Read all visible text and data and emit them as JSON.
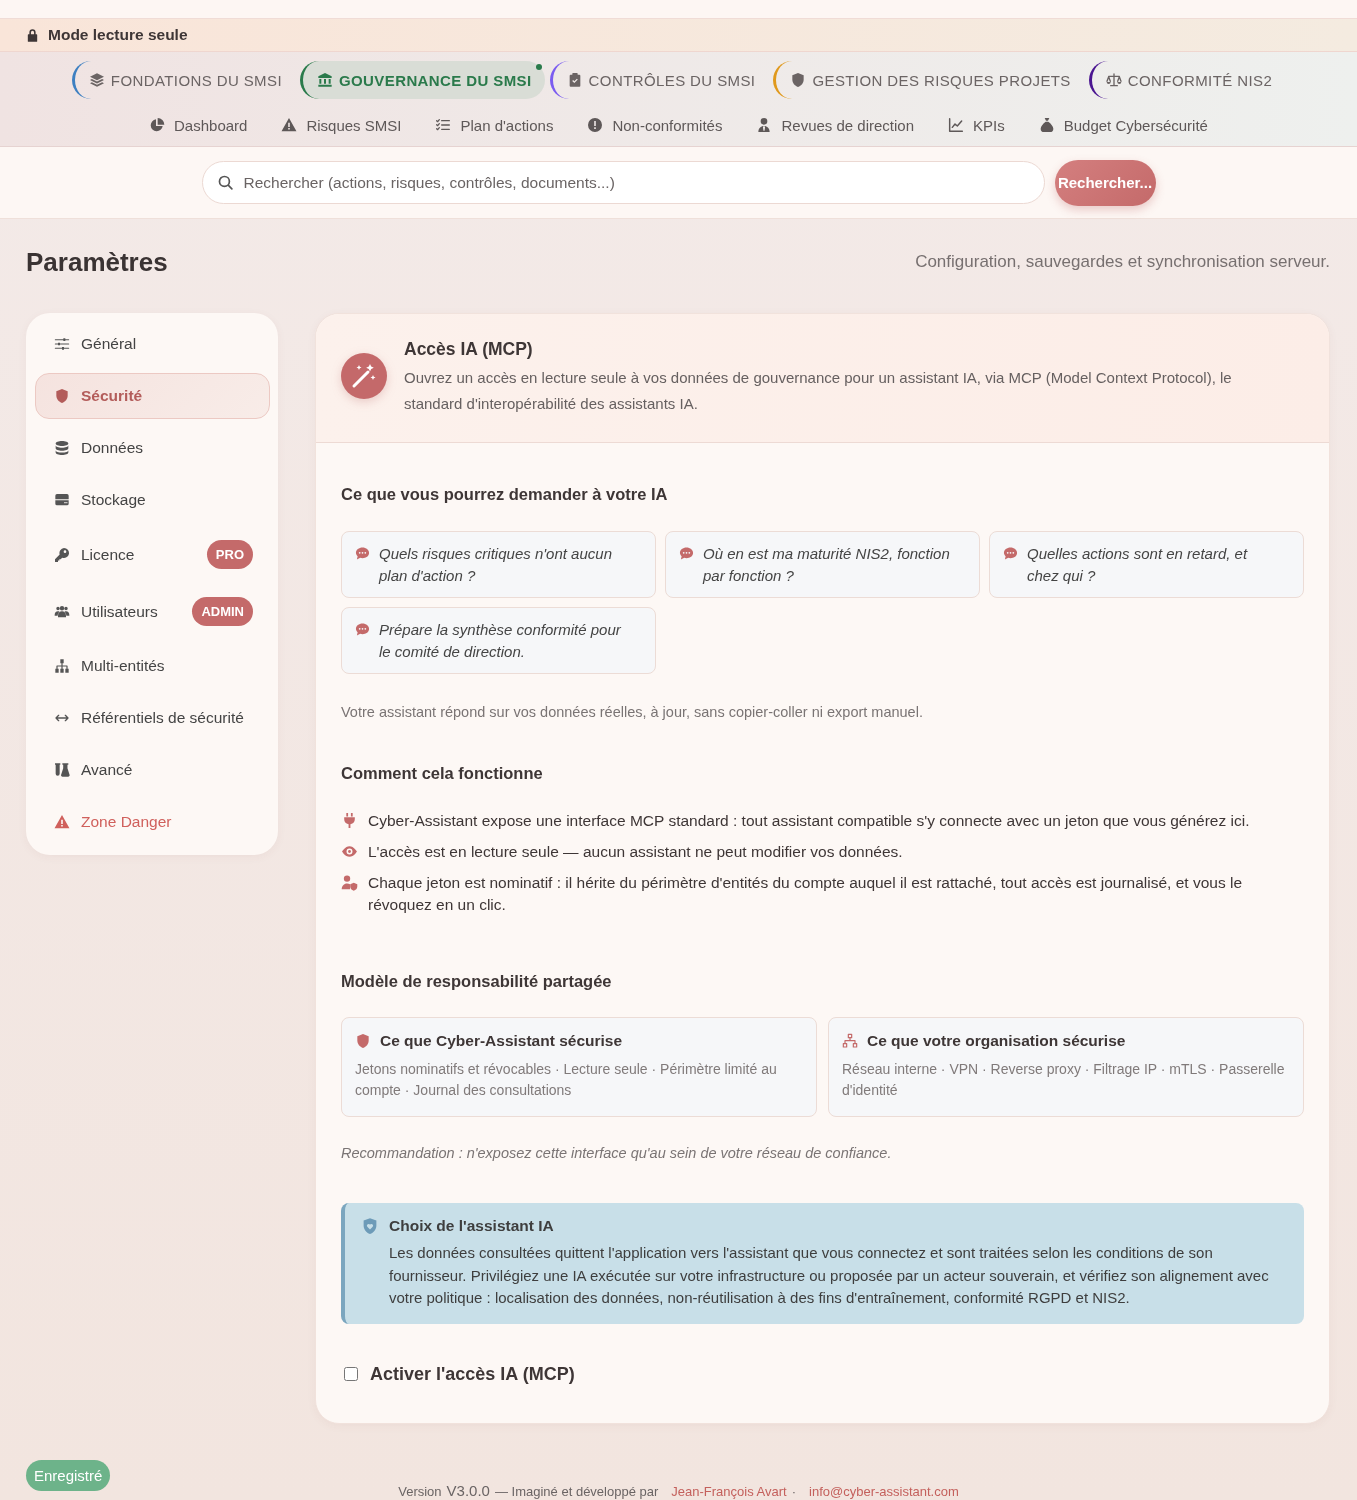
{
  "banner": {
    "text": "Mode lecture seule"
  },
  "modules": [
    {
      "label": "FONDATIONS DU SMSI",
      "color": "#3d7fc1",
      "selected": false
    },
    {
      "label": "GOUVERNANCE DU SMSI",
      "color": "#2a7a4b",
      "selected": true
    },
    {
      "label": "CONTRÔLES DU SMSI",
      "color": "#7b5cf0",
      "selected": false
    },
    {
      "label": "GESTION DES RISQUES PROJETS",
      "color": "#e0991c",
      "selected": false
    },
    {
      "label": "CONFORMITÉ NIS2",
      "color": "#4b1691",
      "selected": false
    }
  ],
  "subnav": [
    {
      "label": "Dashboard"
    },
    {
      "label": "Risques SMSI"
    },
    {
      "label": "Plan d'actions"
    },
    {
      "label": "Non-conformités"
    },
    {
      "label": "Revues de direction"
    },
    {
      "label": "KPIs"
    },
    {
      "label": "Budget Cybersécurité"
    }
  ],
  "search": {
    "placeholder": "Rechercher (actions, risques, contrôles, documents...)",
    "button": "Rechercher..."
  },
  "page": {
    "title": "Paramètres",
    "subtitle": "Configuration, sauvegardes et synchronisation serveur."
  },
  "sidebar": {
    "items": [
      {
        "label": "Général",
        "kind": "normal",
        "selected": false
      },
      {
        "label": "Sécurité",
        "kind": "normal",
        "selected": true
      },
      {
        "label": "Données",
        "kind": "normal",
        "selected": false
      },
      {
        "label": "Stockage",
        "kind": "normal",
        "selected": false
      },
      {
        "label": "Licence",
        "kind": "normal",
        "selected": false,
        "badge": "PRO"
      },
      {
        "label": "Utilisateurs",
        "kind": "normal",
        "selected": false,
        "badge": "ADMIN"
      },
      {
        "label": "Multi-entités",
        "kind": "normal",
        "selected": false
      },
      {
        "label": "Référentiels de sécurité",
        "kind": "normal",
        "selected": false
      },
      {
        "label": "Avancé",
        "kind": "normal",
        "selected": false
      },
      {
        "label": "Zone Danger",
        "kind": "danger",
        "selected": false
      }
    ]
  },
  "panel": {
    "title": "Accès IA (MCP)",
    "description": "Ouvrez un accès en lecture seule à vos données de gouvernance pour un assistant IA, via MCP (Model Context Protocol), le standard d'interopérabilité des assistants IA.",
    "examples": {
      "heading": "Ce que vous pourrez demander à votre IA",
      "items": [
        "Quels risques critiques n'ont aucun plan d'action ?",
        "Où en est ma maturité NIS2, fonction par fonction ?",
        "Quelles actions sont en retard, et chez qui ?",
        "Prépare la synthèse conformité pour le comité de direction."
      ],
      "note": "Votre assistant répond sur vos données réelles, à jour, sans copier-coller ni export manuel."
    },
    "how_it_works": {
      "heading": "Comment cela fonctionne",
      "items": [
        "Cyber-Assistant expose une interface MCP standard : tout assistant compatible s'y connecte avec un jeton que vous générez ici.",
        "L'accès est en lecture seule — aucun assistant ne peut modifier vos données.",
        "Chaque jeton est nominatif : il hérite du périmètre d'entités du compte auquel il est rattaché, tout accès est journalisé, et vous le révoquez en un clic."
      ]
    },
    "shared_responsibility": {
      "heading": "Modèle de responsabilité partagée",
      "cards": [
        {
          "title": "Ce que Cyber-Assistant sécurise",
          "text": "Jetons nominatifs et révocables · Lecture seule · Périmètre limité au compte · Journal des consultations"
        },
        {
          "title": "Ce que votre organisation sécurise",
          "text": "Réseau interne · VPN · Reverse proxy · Filtrage IP · mTLS · Passerelle d'identité"
        }
      ],
      "recommendation": "Recommandation : n'exposez cette interface qu'au sein de votre réseau de confiance."
    },
    "callout": {
      "title": "Choix de l'assistant IA",
      "text": "Les données consultées quittent l'application vers l'assistant que vous connectez et sont traitées selon les conditions de son fournisseur. Privilégiez une IA exécutée sur votre infrastructure ou proposée par un acteur souverain, et vérifiez son alignement avec votre politique : localisation des données, non-réutilisation à des fins d'entraînement, conformité RGPD et NIS2."
    },
    "toggle": {
      "label": "Activer l'accès IA (MCP)",
      "checked": false
    }
  },
  "toast": {
    "text": "Enregistré"
  },
  "footer": {
    "version_label": "Version",
    "version": "V3.0.0",
    "credit": "— Imaginé et développé par",
    "author": "Jean-François Avart",
    "separator": "·",
    "email": "info@cyber-assistant.com"
  }
}
